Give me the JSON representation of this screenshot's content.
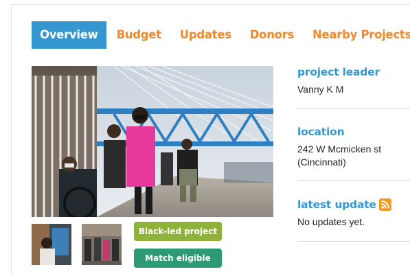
{
  "tabs": [
    {
      "label": "Overview",
      "active": true
    },
    {
      "label": "Budget",
      "active": false
    },
    {
      "label": "Updates",
      "active": false
    },
    {
      "label": "Donors",
      "active": false
    },
    {
      "label": "Nearby Projects",
      "active": false
    }
  ],
  "tags": {
    "black_led": "Black-led project",
    "match": "Match eligible"
  },
  "sidebar": {
    "leader": {
      "heading": "project leader",
      "value": "Vanny K M"
    },
    "location": {
      "heading": "location",
      "line1": "242 W Mcmicken st",
      "line2": "(Cincinnati)"
    },
    "update": {
      "heading": "latest update",
      "value": "No updates yet.",
      "icon": "rss-icon"
    }
  },
  "colors": {
    "accent_blue": "#3597cf",
    "tab_orange": "#ee8a2b",
    "tag_green": "#8fb339",
    "tag_teal": "#2e9a74",
    "rss_orange": "#f39a1e"
  }
}
